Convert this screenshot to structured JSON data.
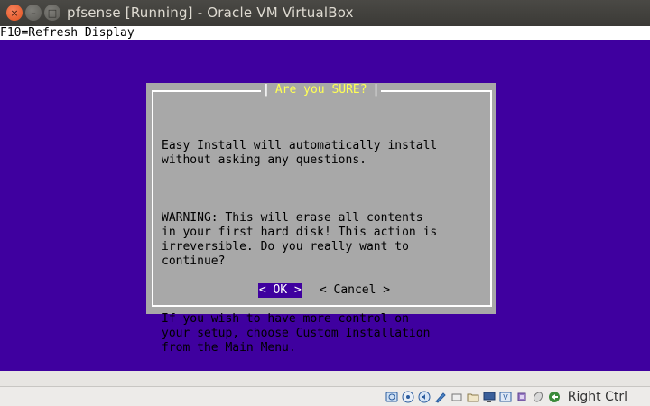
{
  "window": {
    "title": "pfsense [Running] - Oracle VM VirtualBox",
    "close_glyph": "×",
    "minimize_glyph": "–",
    "maximize_glyph": "□"
  },
  "console": {
    "hotkey_bar": "F10=Refresh Display",
    "background_color": "#3f009f"
  },
  "dialog": {
    "title": "Are you SURE?",
    "paragraphs": [
      "Easy Install will automatically install\nwithout asking any questions.",
      "WARNING: This will erase all contents\nin your first hard disk! This action is\nirreversible. Do you really want to\ncontinue?",
      "If you wish to have more control on\nyour setup, choose Custom Installation\nfrom the Main Menu."
    ],
    "ok_label": "< OK >",
    "cancel_label": "< Cancel >"
  },
  "statusbar": {
    "icons": [
      "hard-disk-icon",
      "optical-drive-icon",
      "audio-icon",
      "network-icon",
      "usb-icon",
      "shared-folders-icon",
      "display-icon",
      "video-capture-icon",
      "cpu-icon",
      "mouse-integration-icon",
      "host-key-arrow-icon"
    ],
    "host_key": "Right Ctrl"
  }
}
